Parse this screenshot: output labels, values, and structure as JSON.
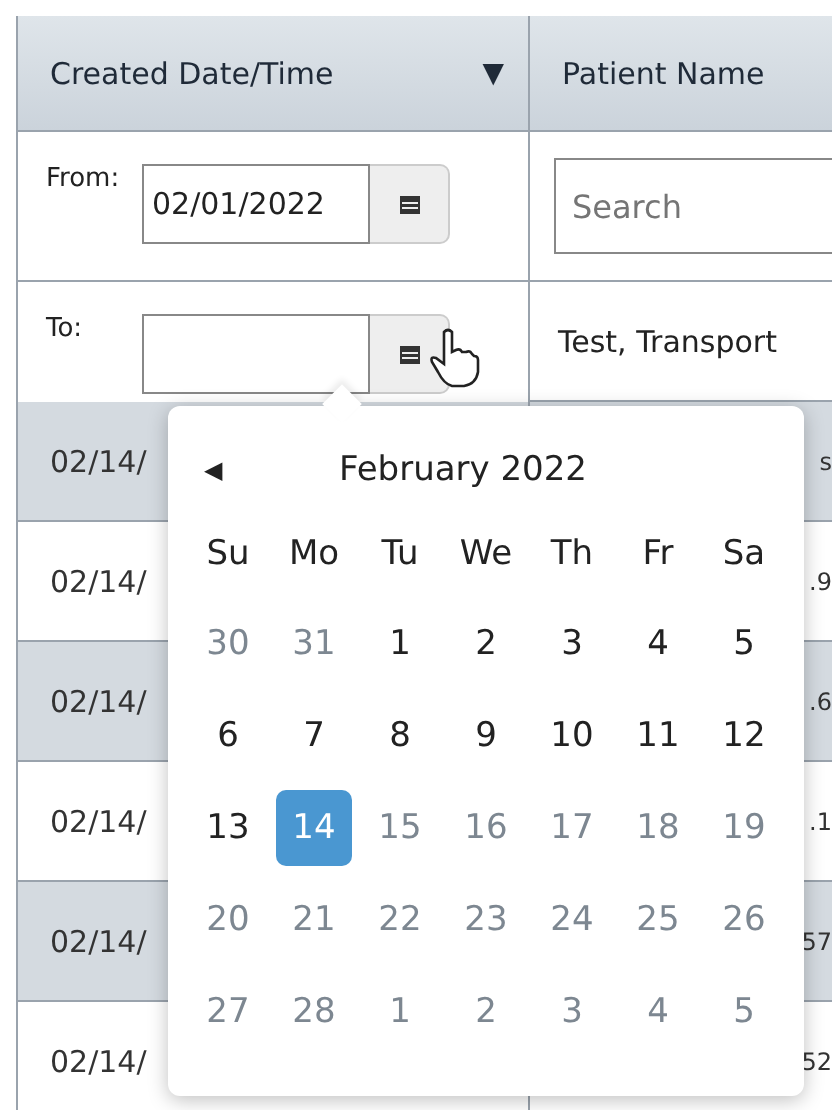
{
  "table": {
    "columns": [
      {
        "label": "Created Date/Time",
        "sort_icon": "▼"
      },
      {
        "label": "Patient Name"
      }
    ],
    "filters": {
      "from_label": "From:",
      "from_value": "02/01/2022",
      "to_label": "To:",
      "search_placeholder": "Search"
    },
    "first_row_patient": "Test, Transport",
    "rows": [
      {
        "date": "02/14/",
        "column_2": "s",
        "shaded": true
      },
      {
        "date": "02/14/",
        "column_2": ".9",
        "shaded": false
      },
      {
        "date": "02/14/",
        "column_2": ".6",
        "shaded": true
      },
      {
        "date": "02/14/",
        "column_2": ".1",
        "shaded": false
      },
      {
        "date": "02/14/",
        "column_2": "57",
        "shaded": true
      },
      {
        "date": "02/14/",
        "column_2": "52",
        "shaded": false
      }
    ]
  },
  "datepicker": {
    "prev": "◀",
    "month": "February 2022",
    "weekdays": [
      "Su",
      "Mo",
      "Tu",
      "We",
      "Th",
      "Fr",
      "Sa"
    ],
    "weeks": [
      [
        {
          "d": "30",
          "muted": true,
          "selected": false
        },
        {
          "d": "31",
          "muted": true,
          "selected": false
        },
        {
          "d": "1",
          "muted": false,
          "selected": false
        },
        {
          "d": "2",
          "muted": false,
          "selected": false
        },
        {
          "d": "3",
          "muted": false,
          "selected": false
        },
        {
          "d": "4",
          "muted": false,
          "selected": false
        },
        {
          "d": "5",
          "muted": false,
          "selected": false
        }
      ],
      [
        {
          "d": "6",
          "muted": false,
          "selected": false
        },
        {
          "d": "7",
          "muted": false,
          "selected": false
        },
        {
          "d": "8",
          "muted": false,
          "selected": false
        },
        {
          "d": "9",
          "muted": false,
          "selected": false
        },
        {
          "d": "10",
          "muted": false,
          "selected": false
        },
        {
          "d": "11",
          "muted": false,
          "selected": false
        },
        {
          "d": "12",
          "muted": false,
          "selected": false
        }
      ],
      [
        {
          "d": "13",
          "muted": false,
          "selected": false
        },
        {
          "d": "14",
          "muted": false,
          "selected": true
        },
        {
          "d": "15",
          "muted": true,
          "selected": false
        },
        {
          "d": "16",
          "muted": true,
          "selected": false
        },
        {
          "d": "17",
          "muted": true,
          "selected": false
        },
        {
          "d": "18",
          "muted": true,
          "selected": false
        },
        {
          "d": "19",
          "muted": true,
          "selected": false
        }
      ],
      [
        {
          "d": "20",
          "muted": true,
          "selected": false
        },
        {
          "d": "21",
          "muted": true,
          "selected": false
        },
        {
          "d": "22",
          "muted": true,
          "selected": false
        },
        {
          "d": "23",
          "muted": true,
          "selected": false
        },
        {
          "d": "24",
          "muted": true,
          "selected": false
        },
        {
          "d": "25",
          "muted": true,
          "selected": false
        },
        {
          "d": "26",
          "muted": true,
          "selected": false
        }
      ],
      [
        {
          "d": "27",
          "muted": true,
          "selected": false
        },
        {
          "d": "28",
          "muted": true,
          "selected": false
        },
        {
          "d": "1",
          "muted": true,
          "selected": false
        },
        {
          "d": "2",
          "muted": true,
          "selected": false
        },
        {
          "d": "3",
          "muted": true,
          "selected": false
        },
        {
          "d": "4",
          "muted": true,
          "selected": false
        },
        {
          "d": "5",
          "muted": true,
          "selected": false
        }
      ]
    ]
  }
}
